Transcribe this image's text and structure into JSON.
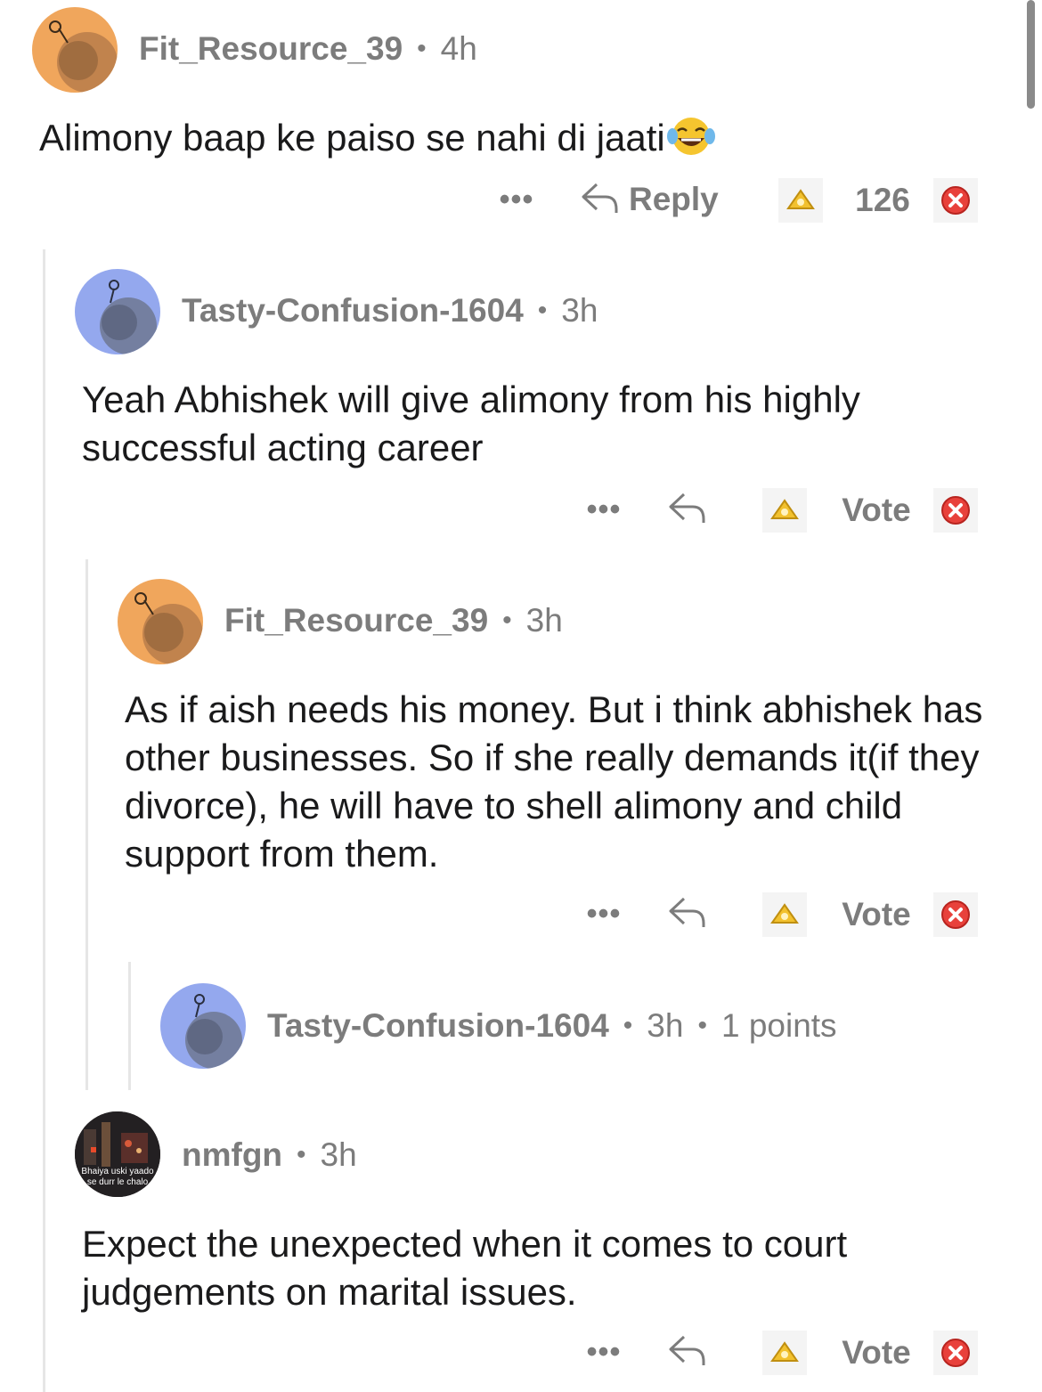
{
  "comments": [
    {
      "username": "Fit_Resource_39",
      "age": "4h",
      "avatar_color": "#f0a65c",
      "text": "Alimony baap ke paiso se nahi di jaati",
      "emoji": "laughing-tears-emoji",
      "actions": {
        "more": "•••",
        "reply": "Reply",
        "score": "126"
      }
    },
    {
      "username": "Tasty-Confusion-1604",
      "age": "3h",
      "avatar_color": "#94a8ee",
      "text": "Yeah Abhishek will give alimony from his highly successful acting career",
      "actions": {
        "more": "•••",
        "score": "Vote"
      }
    },
    {
      "username": "Fit_Resource_39",
      "age": "3h",
      "avatar_color": "#f0a65c",
      "text": "As if aish needs his money. But i think abhishek has other businesses. So if she really demands it(if they divorce), he will have to shell alimony and child support from them.",
      "actions": {
        "more": "•••",
        "score": "Vote"
      }
    },
    {
      "username": "Tasty-Confusion-1604",
      "age": "3h",
      "points": "1 points",
      "avatar_color": "#94a8ee"
    },
    {
      "username": "nmfgn",
      "age": "3h",
      "avatar_caption": "Bhaiya uski yaado se durr le chalo",
      "text": "Expect the unexpected when it comes to court judgements on marital issues.",
      "actions": {
        "more": "•••",
        "score": "Vote"
      }
    }
  ],
  "icons": {
    "reply": "reply-arrow-icon",
    "upvote": "upvote-icon",
    "downvote": "downvote-icon",
    "more": "more-options-icon"
  },
  "colors": {
    "upvote_yellow": "#f2c12e",
    "downvote_red": "#e8413b",
    "meta_gray": "#7c7c7c"
  }
}
